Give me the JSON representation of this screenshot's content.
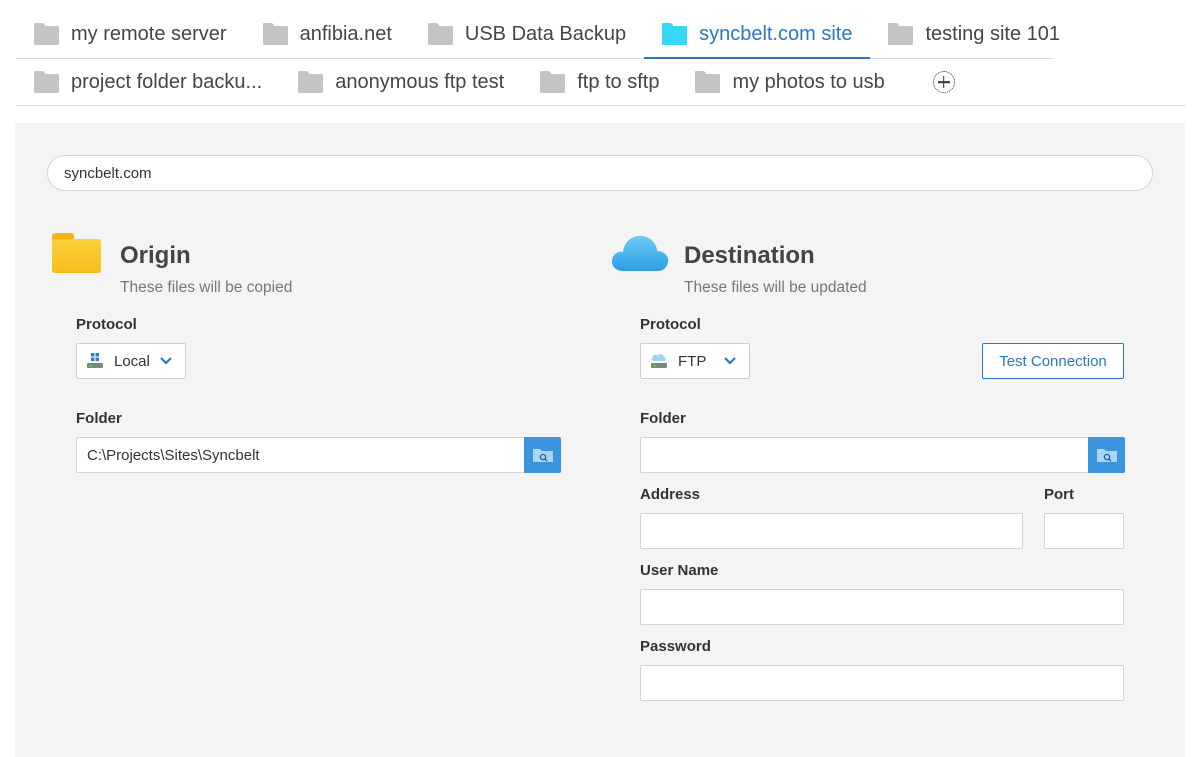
{
  "tabs": {
    "row1": [
      {
        "label": "my remote server",
        "active": false
      },
      {
        "label": "anfibia.net",
        "active": false
      },
      {
        "label": "USB Data Backup",
        "active": false
      },
      {
        "label": "syncbelt.com site",
        "active": true
      },
      {
        "label": "testing site 101",
        "active": false
      }
    ],
    "row2": [
      {
        "label": "project folder backu...",
        "active": false
      },
      {
        "label": "anonymous ftp test",
        "active": false
      },
      {
        "label": "ftp to sftp",
        "active": false
      },
      {
        "label": "my photos to usb",
        "active": false
      }
    ],
    "add_icon": "add-circle-icon"
  },
  "job": {
    "name": "syncbelt.com"
  },
  "origin": {
    "title": "Origin",
    "subtitle": "These files will be copied",
    "icon": "folder-icon",
    "protocol_label": "Protocol",
    "protocol_value": "Local",
    "folder_label": "Folder",
    "folder_value": "C:\\Projects\\Sites\\Syncbelt"
  },
  "destination": {
    "title": "Destination",
    "subtitle": "These files will be updated",
    "icon": "cloud-icon",
    "protocol_label": "Protocol",
    "protocol_value": "FTP",
    "test_connection_label": "Test Connection",
    "folder_label": "Folder",
    "folder_value": "",
    "address_label": "Address",
    "address_value": "",
    "port_label": "Port",
    "port_value": "",
    "username_label": "User Name",
    "username_value": "",
    "password_label": "Password",
    "password_value": ""
  },
  "colors": {
    "accent": "#2b78c0",
    "active_folder": "#36d7f4",
    "browse_button": "#3a94de",
    "panel_bg": "#f4f4f4"
  }
}
